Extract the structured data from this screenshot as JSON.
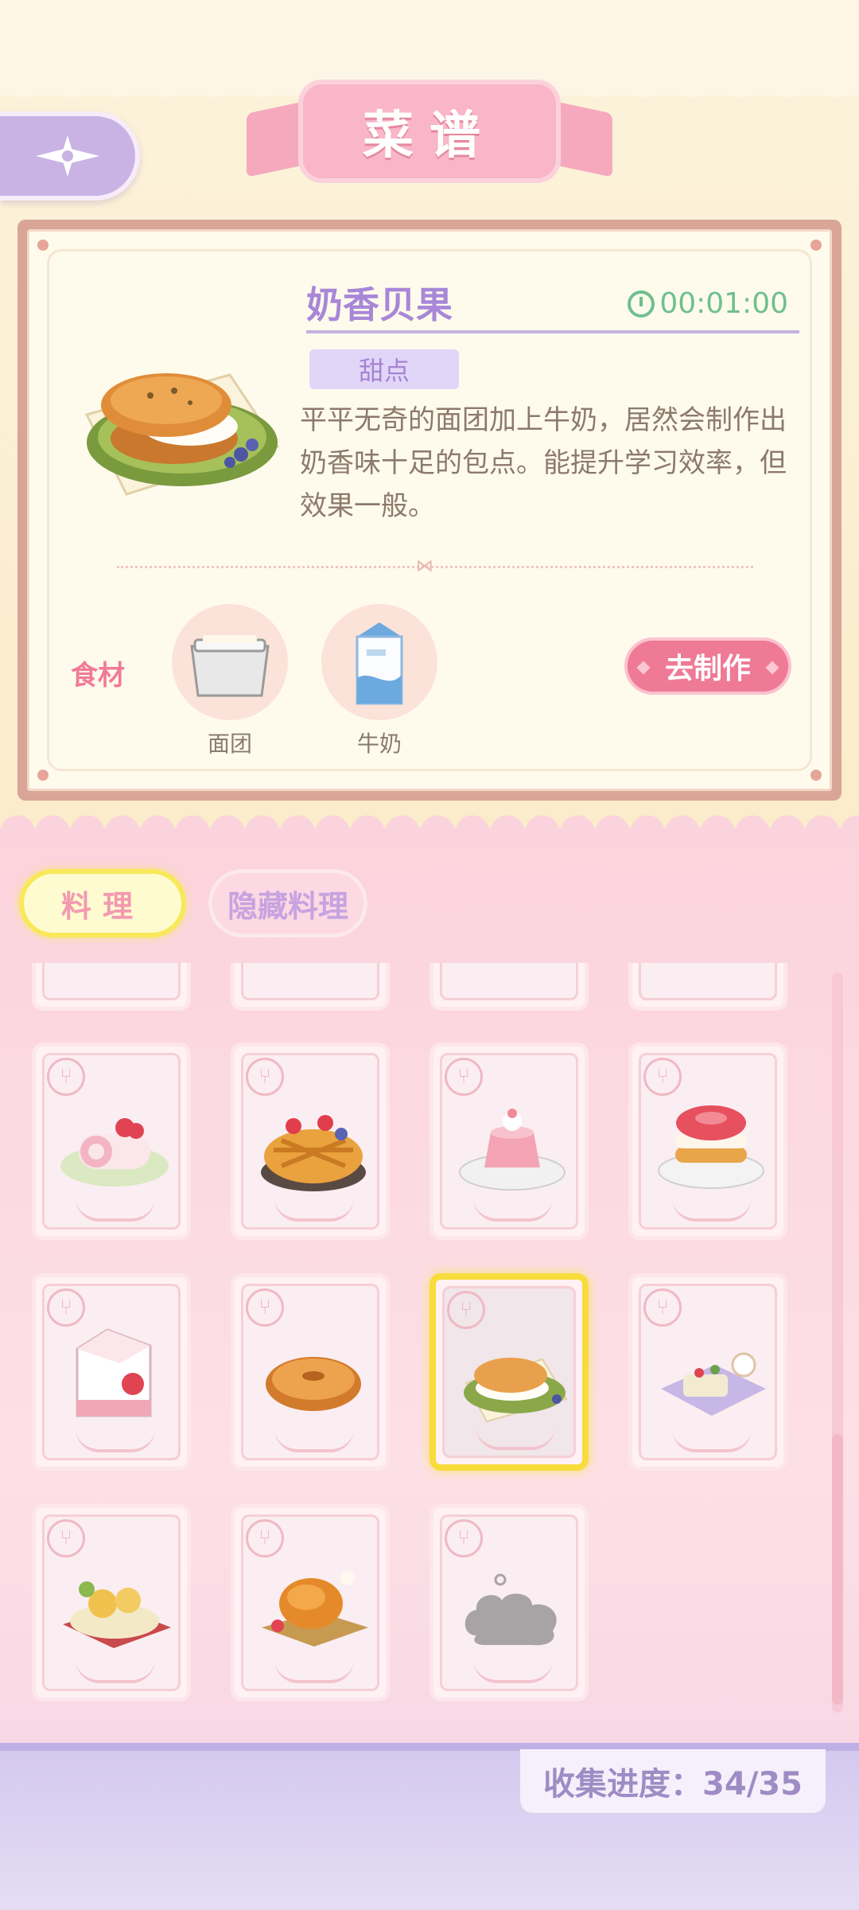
{
  "header": {
    "title": "菜谱",
    "back_icon": "compass-arrow-icon"
  },
  "recipe": {
    "name": "奶香贝果",
    "timer": "00:01:00",
    "category": "甜点",
    "description": "平平无奇的面团加上牛奶，居然会制作出奶香味十足的包点。能提升学习效率，但效果一般。",
    "ingredients_label": "食材",
    "ingredients": [
      {
        "name": "面团"
      },
      {
        "name": "牛奶"
      }
    ],
    "make_button": "去制作"
  },
  "tabs": {
    "active": "料理",
    "hidden": "隐藏料理"
  },
  "dishes": [
    {
      "name": "strawberry-roll-cake",
      "selected": false,
      "locked": false
    },
    {
      "name": "fruit-tart",
      "selected": false,
      "locked": false
    },
    {
      "name": "strawberry-jelly",
      "selected": false,
      "locked": false
    },
    {
      "name": "strawberry-pancakes",
      "selected": false,
      "locked": false
    },
    {
      "name": "strawberry-milk",
      "selected": false,
      "locked": false
    },
    {
      "name": "bagel",
      "selected": false,
      "locked": false
    },
    {
      "name": "milk-bagel",
      "selected": true,
      "locked": false
    },
    {
      "name": "tea-set",
      "selected": false,
      "locked": false
    },
    {
      "name": "pastry-platter",
      "selected": false,
      "locked": false
    },
    {
      "name": "roast-chicken",
      "selected": false,
      "locked": false
    },
    {
      "name": "locked-dish",
      "selected": false,
      "locked": true
    }
  ],
  "colors": {
    "accent_pink": "#ef7a96",
    "accent_purple": "#a887d8",
    "timer_green": "#6ec08d",
    "selected_yellow": "#f8dc3c"
  },
  "footer": {
    "progress": "收集进度：34/35"
  }
}
